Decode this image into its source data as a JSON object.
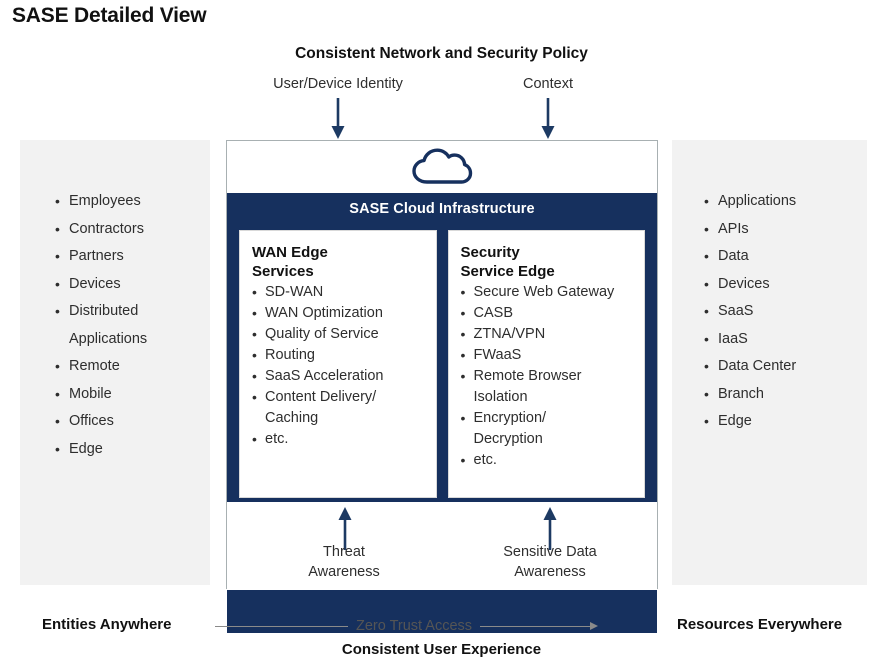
{
  "title": "SASE Detailed View",
  "top": {
    "policy_title": "Consistent Network and Security Policy",
    "identity_label": "User/Device Identity",
    "context_label": "Context",
    "identity_arrow_icon": "arrow-down-icon",
    "context_arrow_icon": "arrow-down-icon"
  },
  "left_panel": {
    "items": [
      "Employees",
      "Contractors",
      "Partners",
      "Devices",
      "Distributed\nApplications",
      "Remote",
      "Mobile",
      "Offices",
      "Edge"
    ]
  },
  "right_panel": {
    "items": [
      "Applications",
      "APIs",
      "Data",
      "Devices",
      "SaaS",
      "IaaS",
      "Data Center",
      "Branch",
      "Edge"
    ]
  },
  "center": {
    "cloud_icon": "cloud-icon",
    "band_title": "SASE Cloud Infrastructure",
    "cards": [
      {
        "title": "WAN Edge\nServices",
        "items": [
          "SD-WAN",
          "WAN Optimization",
          "Quality of Service",
          "Routing",
          "SaaS Acceleration",
          "Content Delivery/\nCaching",
          "etc."
        ]
      },
      {
        "title": "Security\nService Edge",
        "items": [
          "Secure Web Gateway",
          "CASB",
          "ZTNA/VPN",
          "FWaaS",
          "Remote Browser\nIsolation",
          "Encryption/\nDecryption",
          "etc."
        ]
      }
    ],
    "awareness": {
      "threat_label": "Threat\nAwareness",
      "sensitive_label": "Sensitive Data\nAwareness",
      "threat_arrow_icon": "arrow-up-icon",
      "sensitive_arrow_icon": "arrow-up-icon"
    }
  },
  "footer": {
    "left_label": "Entities Anywhere",
    "right_label": "Resources Everywhere",
    "connector_label": "Zero Trust Access",
    "connector_arrow_icon": "arrow-right-icon",
    "bottom_label": "Consistent User Experience"
  },
  "colors": {
    "navy": "#16305e",
    "panel_gray": "#f2f2f2",
    "border_gray": "#a8b0b2",
    "text": "#2e2e2e"
  }
}
